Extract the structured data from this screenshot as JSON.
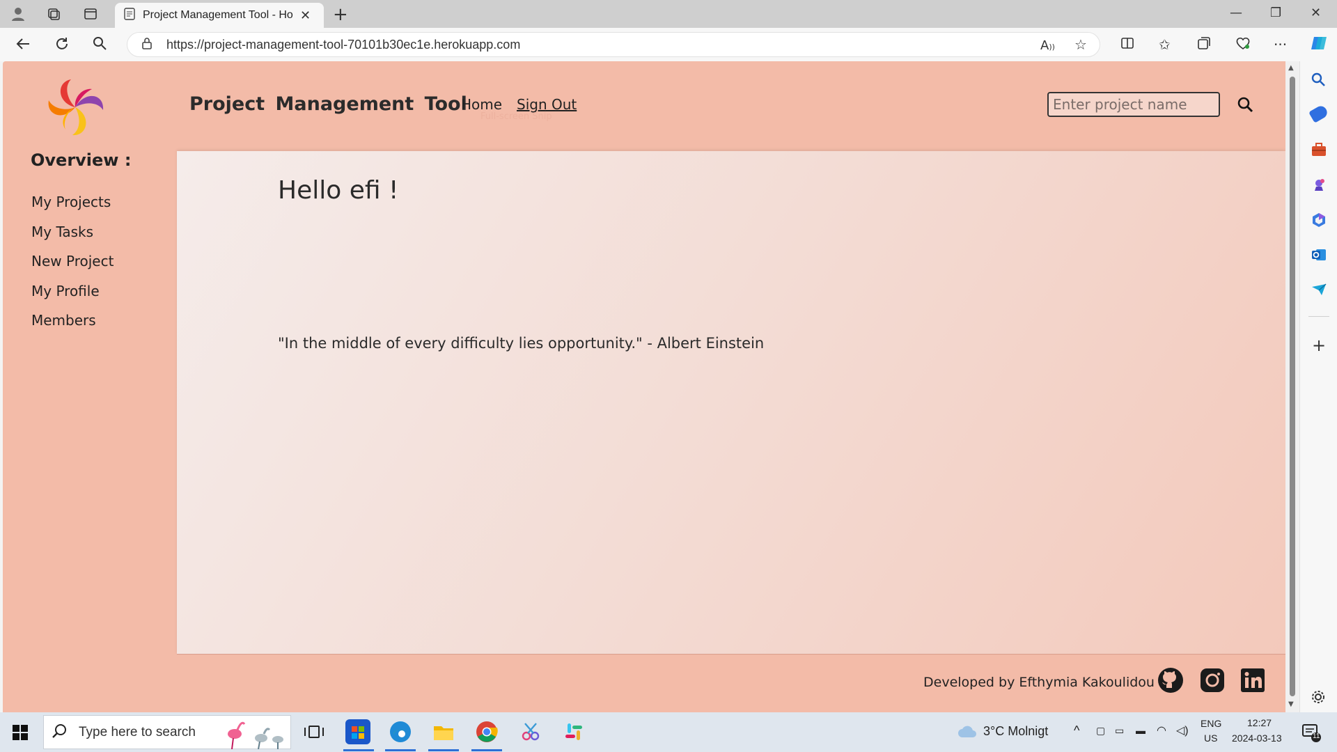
{
  "browser": {
    "tab_title": "Project Management Tool - Hom",
    "url": "https://project-management-tool-70101b30ec1e.herokuapp.com"
  },
  "header": {
    "app_title": "Project Management Tool",
    "nav_home": "Home",
    "nav_signout": "Sign Out",
    "ghost_text": "Full-screen Snip",
    "search_placeholder": "Enter project name"
  },
  "sidebar": {
    "heading": "Overview :",
    "items": [
      {
        "label": "My Projects"
      },
      {
        "label": "My Tasks"
      },
      {
        "label": "New Project"
      },
      {
        "label": "My Profile"
      },
      {
        "label": "Members"
      }
    ]
  },
  "main": {
    "greeting": "Hello efi !",
    "quote": "\"In the middle of every difficulty lies opportunity.\" - Albert Einstein"
  },
  "footer": {
    "credit": "Developed by Efthymia Kakoulidou",
    "socials": [
      "github-icon",
      "instagram-icon",
      "linkedin-icon"
    ]
  },
  "taskbar": {
    "search_text": "Type here to search",
    "weather": "3°C  Molnigt",
    "lang_top": "ENG",
    "lang_bottom": "US",
    "time": "12:27",
    "date": "2024-03-13",
    "notif_count": "11"
  },
  "colors": {
    "page_bg": "#f3bba8",
    "main_panel_start": "#f5ecea",
    "main_panel_end": "#f3c9bb",
    "text": "#222222"
  }
}
